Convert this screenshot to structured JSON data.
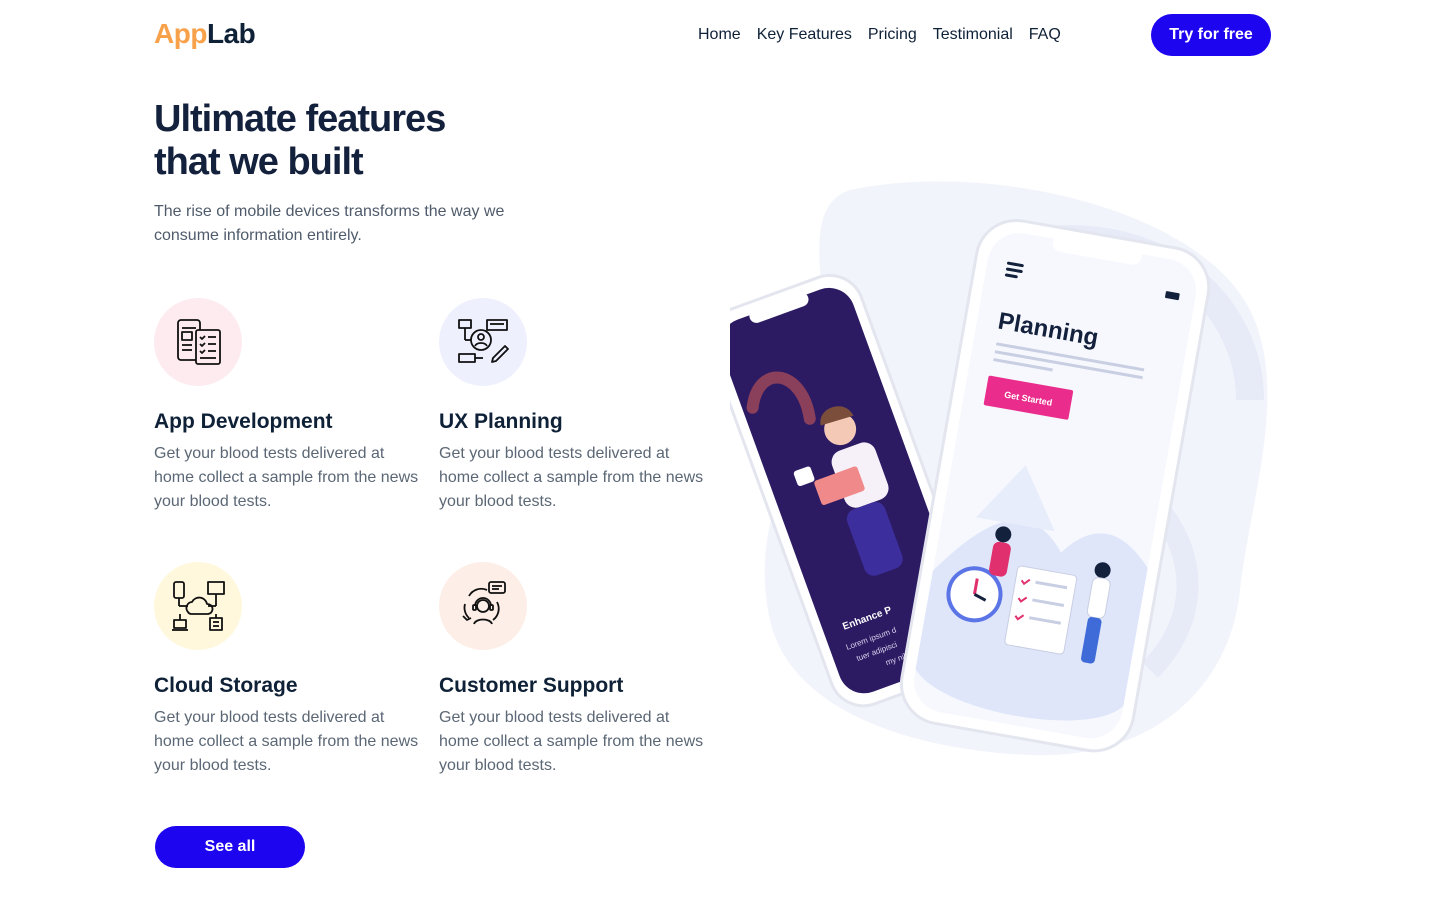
{
  "brand": {
    "part1": "App",
    "part2": "Lab",
    "accent": "#f7a14a",
    "dark": "#0f2137"
  },
  "nav": {
    "items": [
      {
        "label": "Home"
      },
      {
        "label": "Key Features"
      },
      {
        "label": "Pricing"
      },
      {
        "label": "Testimonial"
      },
      {
        "label": "FAQ"
      }
    ],
    "cta_label": "Try for free"
  },
  "colors": {
    "primary": "#1e05f0",
    "heading": "#14213d",
    "body": "#5b6775"
  },
  "section": {
    "title_line1": "Ultimate features",
    "title_line2": "that we built",
    "subtitle": "The rise of mobile devices transforms the way we consume information entirely."
  },
  "features": [
    {
      "title": "App Development",
      "text": "Get your blood tests delivered at home collect a sample from the news your blood tests.",
      "icon": "app-development-icon",
      "bg": "#fdebef"
    },
    {
      "title": "UX Planning",
      "text": "Get your blood tests delivered at home collect a sample from the news your blood tests.",
      "icon": "ux-planning-icon",
      "bg": "#eef0fd"
    },
    {
      "title": "Cloud Storage",
      "text": "Get your blood tests delivered at home collect a sample from the news your blood tests.",
      "icon": "cloud-storage-icon",
      "bg": "#fff8dc"
    },
    {
      "title": "Customer Support",
      "text": "Get your blood tests delivered at home collect a sample from the news your blood tests.",
      "icon": "customer-support-icon",
      "bg": "#fdeee7"
    }
  ],
  "see_all_label": "See all",
  "illustration": {
    "front_screen_title": "Planning",
    "front_screen_button": "Get Started",
    "back_screen_title": "Enhance P",
    "back_screen_text1": "Lorem ipsum d",
    "back_screen_text2": "tuer adipisci",
    "back_screen_text3": "my nib"
  }
}
